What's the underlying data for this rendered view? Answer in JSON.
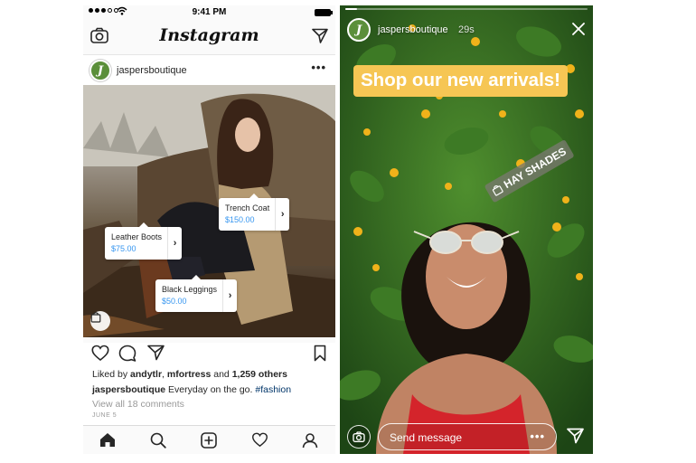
{
  "feed": {
    "status_bar": {
      "time": "9:41 PM"
    },
    "nav": {
      "logo": "Instagram",
      "left_icon": "camera-icon",
      "right_icon": "direct-send-icon"
    },
    "post": {
      "avatar_letter": "J",
      "username": "jaspersboutique",
      "more": "•••",
      "product_tags": [
        {
          "name": "Trench Coat",
          "price": "$150.00"
        },
        {
          "name": "Leather Boots",
          "price": "$75.00"
        },
        {
          "name": "Black Leggings",
          "price": "$50.00"
        }
      ],
      "likes": {
        "prefix": "Liked by",
        "user1": "andytlr",
        "user2": "mfortress",
        "connector": "and",
        "others": "1,259 others"
      },
      "caption": {
        "username": "jaspersboutique",
        "text": "Everyday on the go.",
        "hashtag": "#fashion"
      },
      "view_comments": "View all 18 comments",
      "date": "JUNE 5"
    },
    "tabbar": [
      "home-icon",
      "search-icon",
      "new-post-icon",
      "activity-heart-icon",
      "profile-icon"
    ]
  },
  "story": {
    "progress": 0.05,
    "avatar_letter": "J",
    "username": "jaspersboutique",
    "age": "29s",
    "headline": "Shop our new arrivals!",
    "shopping_sticker": "HAY SHADES",
    "message_placeholder": "Send message",
    "more": "•••"
  },
  "colors": {
    "link_blue": "#3897f0",
    "hashtag": "#003569",
    "headline_bg": "#f6c654",
    "avatar_green": "#5b8f3a"
  }
}
